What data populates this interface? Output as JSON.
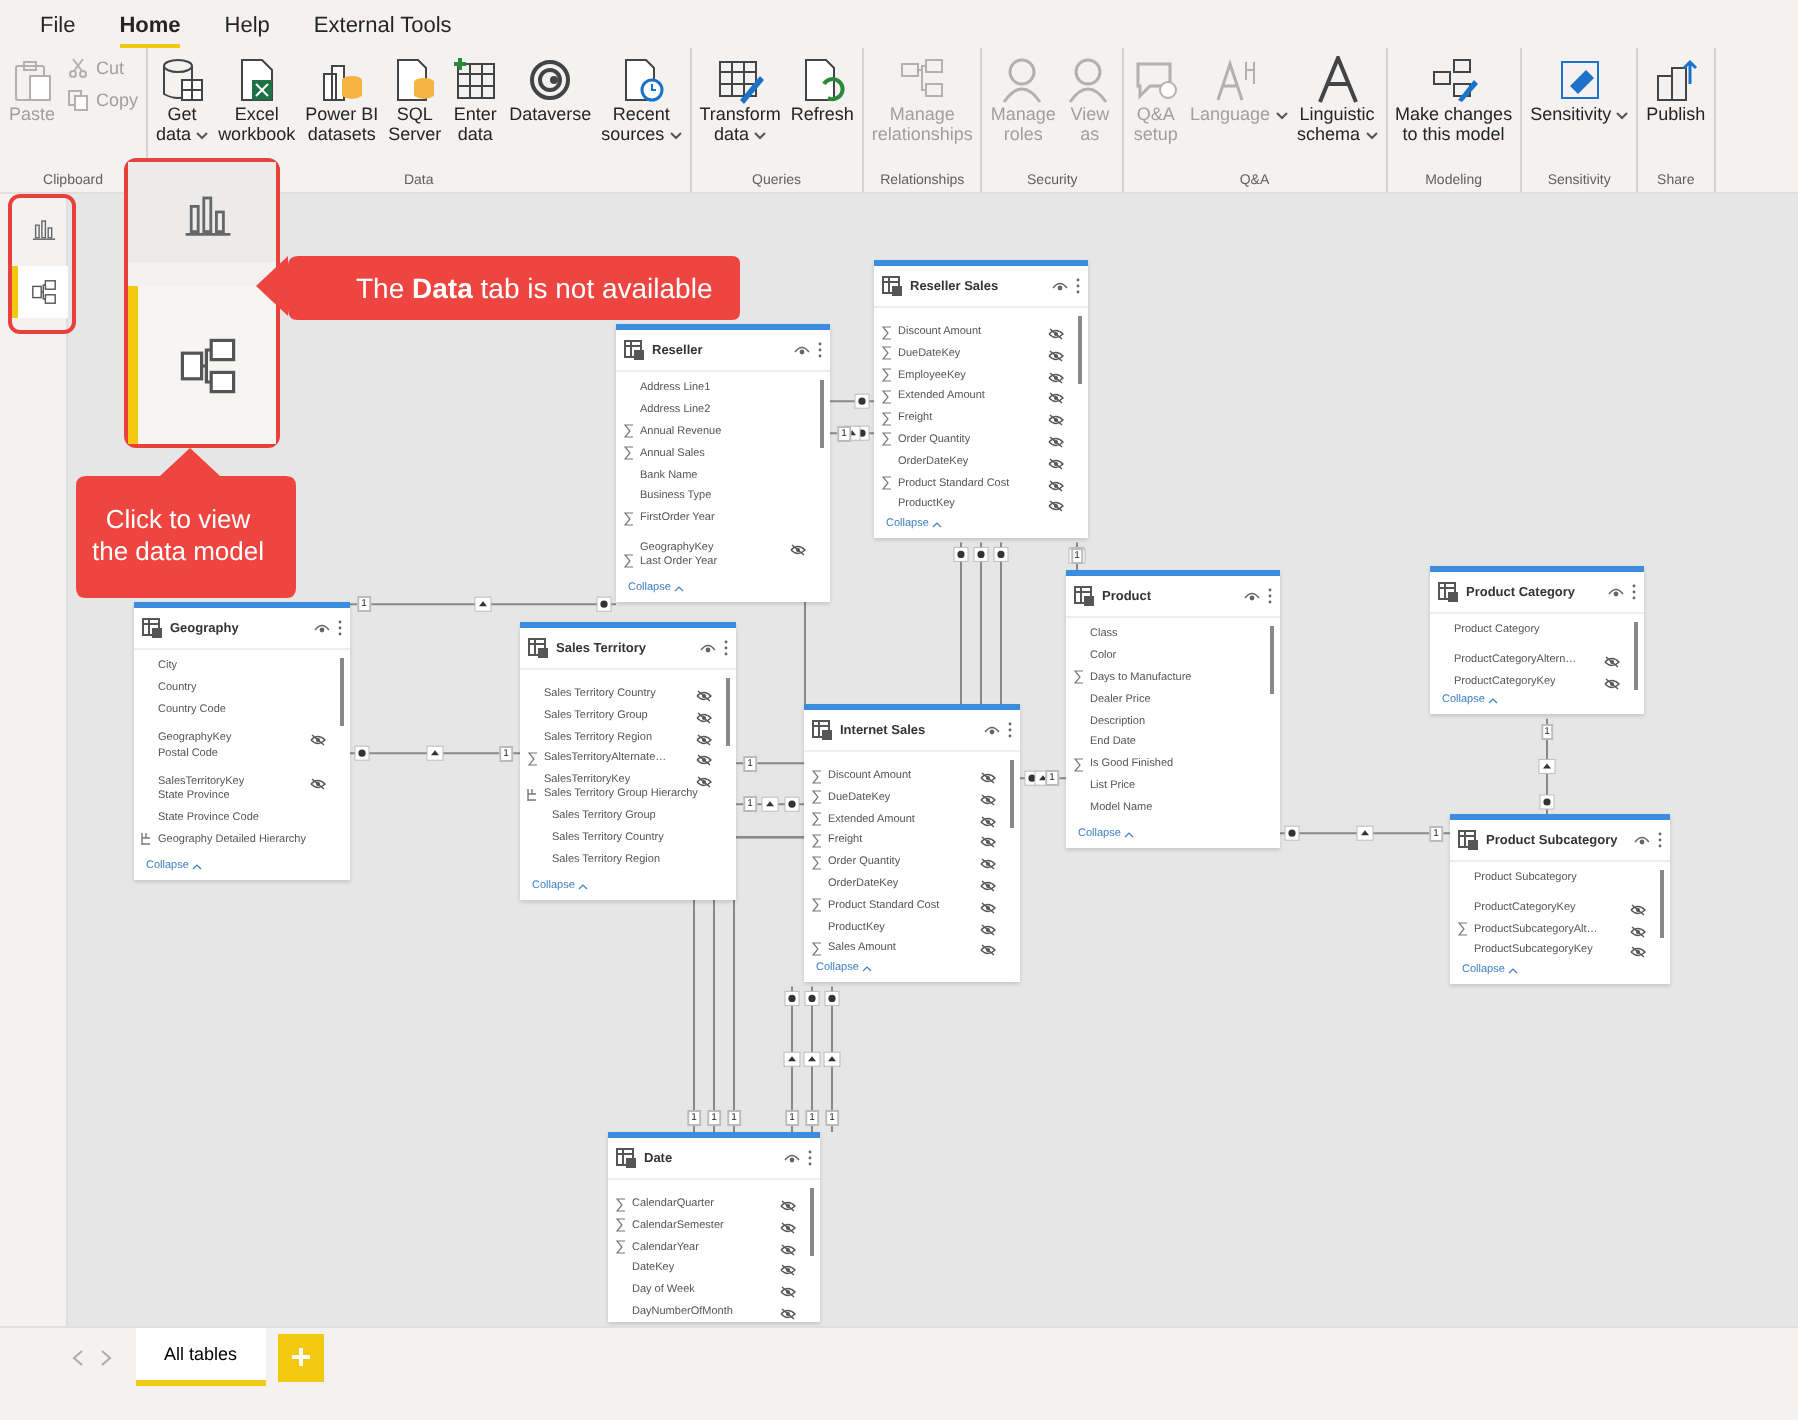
{
  "menu_tabs": [
    {
      "label": "File",
      "selected": false
    },
    {
      "label": "Home",
      "selected": true
    },
    {
      "label": "Help",
      "selected": false
    },
    {
      "label": "External Tools",
      "selected": false
    }
  ],
  "ribbon_groups": [
    {
      "label": "Clipboard",
      "buttons": [
        {
          "label": "Paste",
          "kind": "large",
          "disabled": true,
          "dropdown": false
        },
        {
          "label": "Cut",
          "kind": "small",
          "disabled": true,
          "dropdown": false
        },
        {
          "label": "Copy",
          "kind": "small",
          "disabled": true,
          "dropdown": false
        }
      ]
    },
    {
      "label": "Data",
      "buttons": [
        {
          "label": "Get\ndata",
          "kind": "large",
          "disabled": false,
          "dropdown": true
        },
        {
          "label": "Excel\nworkbook",
          "kind": "large",
          "disabled": false,
          "dropdown": false
        },
        {
          "label": "Power BI\ndatasets",
          "kind": "large",
          "disabled": false,
          "dropdown": false
        },
        {
          "label": "SQL\nServer",
          "kind": "large",
          "disabled": false,
          "dropdown": false
        },
        {
          "label": "Enter\ndata",
          "kind": "large",
          "disabled": false,
          "dropdown": false
        },
        {
          "label": "Dataverse",
          "kind": "large",
          "disabled": false,
          "dropdown": false
        },
        {
          "label": "Recent\nsources",
          "kind": "large",
          "disabled": false,
          "dropdown": true
        }
      ]
    },
    {
      "label": "Queries",
      "buttons": [
        {
          "label": "Transform\ndata",
          "kind": "large",
          "disabled": false,
          "dropdown": true
        },
        {
          "label": "Refresh",
          "kind": "large",
          "disabled": false,
          "dropdown": false
        }
      ]
    },
    {
      "label": "Relationships",
      "buttons": [
        {
          "label": "Manage\nrelationships",
          "kind": "large",
          "disabled": true,
          "dropdown": false
        }
      ]
    },
    {
      "label": "Security",
      "buttons": [
        {
          "label": "Manage\nroles",
          "kind": "large",
          "disabled": true,
          "dropdown": false
        },
        {
          "label": "View\nas",
          "kind": "large",
          "disabled": true,
          "dropdown": false
        }
      ]
    },
    {
      "label": "Q&A",
      "buttons": [
        {
          "label": "Q&A\nsetup",
          "kind": "large",
          "disabled": true,
          "dropdown": false
        },
        {
          "label": "Language",
          "kind": "large",
          "disabled": true,
          "dropdown": true
        },
        {
          "label": "Linguistic\nschema",
          "kind": "large",
          "disabled": false,
          "dropdown": true
        }
      ]
    },
    {
      "label": "Modeling",
      "buttons": [
        {
          "label": "Make changes\nto this model",
          "kind": "large",
          "disabled": false,
          "dropdown": false
        }
      ]
    },
    {
      "label": "Sensitivity",
      "buttons": [
        {
          "label": "Sensitivity",
          "kind": "large",
          "disabled": false,
          "dropdown": true
        }
      ]
    },
    {
      "label": "Share",
      "buttons": [
        {
          "label": "Publish",
          "kind": "large",
          "disabled": false,
          "dropdown": false
        }
      ]
    }
  ],
  "nav_items": [
    {
      "selected": false
    },
    {
      "selected": true
    }
  ],
  "zoom_inset": {
    "items": [
      {
        "selected": false
      },
      {
        "selected": true
      }
    ]
  },
  "callouts": [
    {
      "text": "The **Data** tab is not available"
    },
    {
      "text": "Click to view the data model"
    }
  ],
  "tables": [
    {
      "name": "Reseller",
      "collapse": "Collapse",
      "fields": [
        {
          "name": "Address Line1",
          "kind": "column",
          "hidden": false
        },
        {
          "name": "Address Line2",
          "kind": "column",
          "hidden": false
        },
        {
          "name": "Annual Revenue",
          "kind": "measure",
          "hidden": false
        },
        {
          "name": "Annual Sales",
          "kind": "measure",
          "hidden": false
        },
        {
          "name": "Bank Name",
          "kind": "column",
          "hidden": false
        },
        {
          "name": "Business Type",
          "kind": "column",
          "hidden": false
        },
        {
          "name": "FirstOrder Year",
          "kind": "measure",
          "hidden": false
        },
        {
          "name": "GeographyKey",
          "kind": "column",
          "hidden": true
        },
        {
          "name": "Last Order Year",
          "kind": "measure",
          "hidden": false
        }
      ]
    },
    {
      "name": "Reseller Sales",
      "collapse": "Collapse",
      "fields": [
        {
          "name": "Discount Amount",
          "kind": "measure",
          "hidden": true
        },
        {
          "name": "DueDateKey",
          "kind": "measure",
          "hidden": true
        },
        {
          "name": "EmployeeKey",
          "kind": "measure",
          "hidden": true
        },
        {
          "name": "Extended Amount",
          "kind": "measure",
          "hidden": true
        },
        {
          "name": "Freight",
          "kind": "measure",
          "hidden": true
        },
        {
          "name": "Order Quantity",
          "kind": "measure",
          "hidden": true
        },
        {
          "name": "OrderDateKey",
          "kind": "column",
          "hidden": true
        },
        {
          "name": "Product Standard Cost",
          "kind": "measure",
          "hidden": true
        },
        {
          "name": "ProductKey",
          "kind": "column",
          "hidden": true
        }
      ]
    },
    {
      "name": "Geography",
      "collapse": "Collapse",
      "fields": [
        {
          "name": "City",
          "kind": "column",
          "hidden": false
        },
        {
          "name": "Country",
          "kind": "column",
          "hidden": false
        },
        {
          "name": "Country Code",
          "kind": "column",
          "hidden": false
        },
        {
          "name": "GeographyKey",
          "kind": "column",
          "hidden": true
        },
        {
          "name": "Postal Code",
          "kind": "column",
          "hidden": false
        },
        {
          "name": "SalesTerritoryKey",
          "kind": "column",
          "hidden": true
        },
        {
          "name": "State Province",
          "kind": "column",
          "hidden": false
        },
        {
          "name": "State Province Code",
          "kind": "column",
          "hidden": false
        },
        {
          "name": "Geography Detailed Hierarchy",
          "kind": "hierarchy",
          "hidden": false
        }
      ]
    },
    {
      "name": "Sales Territory",
      "collapse": "Collapse",
      "fields": [
        {
          "name": "Sales Territory Country",
          "kind": "column",
          "hidden": true
        },
        {
          "name": "Sales Territory Group",
          "kind": "column",
          "hidden": true
        },
        {
          "name": "Sales Territory Region",
          "kind": "column",
          "hidden": true
        },
        {
          "name": "SalesTerritoryAlternate…",
          "kind": "measure",
          "hidden": true
        },
        {
          "name": "SalesTerritoryKey",
          "kind": "column",
          "hidden": true
        },
        {
          "name": "Sales Territory Group Hierarchy",
          "kind": "hierarchy",
          "hidden": false
        },
        {
          "name": "Sales Territory Group",
          "kind": "level",
          "hidden": false
        },
        {
          "name": "Sales Territory Country",
          "kind": "level",
          "hidden": false
        },
        {
          "name": "Sales Territory Region",
          "kind": "level",
          "hidden": false
        }
      ]
    },
    {
      "name": "Internet Sales",
      "collapse": "Collapse",
      "fields": [
        {
          "name": "Discount Amount",
          "kind": "measure",
          "hidden": true
        },
        {
          "name": "DueDateKey",
          "kind": "measure",
          "hidden": true
        },
        {
          "name": "Extended Amount",
          "kind": "measure",
          "hidden": true
        },
        {
          "name": "Freight",
          "kind": "measure",
          "hidden": true
        },
        {
          "name": "Order Quantity",
          "kind": "measure",
          "hidden": true
        },
        {
          "name": "OrderDateKey",
          "kind": "column",
          "hidden": true
        },
        {
          "name": "Product Standard Cost",
          "kind": "measure",
          "hidden": true
        },
        {
          "name": "ProductKey",
          "kind": "column",
          "hidden": true
        },
        {
          "name": "Sales Amount",
          "kind": "measure",
          "hidden": true
        }
      ]
    },
    {
      "name": "Product",
      "collapse": "Collapse",
      "fields": [
        {
          "name": "Class",
          "kind": "column",
          "hidden": false
        },
        {
          "name": "Color",
          "kind": "column",
          "hidden": false
        },
        {
          "name": "Days to Manufacture",
          "kind": "measure",
          "hidden": false
        },
        {
          "name": "Dealer Price",
          "kind": "column",
          "hidden": false
        },
        {
          "name": "Description",
          "kind": "column",
          "hidden": false
        },
        {
          "name": "End Date",
          "kind": "column",
          "hidden": false
        },
        {
          "name": "Is Good Finished",
          "kind": "measure",
          "hidden": false
        },
        {
          "name": "List Price",
          "kind": "column",
          "hidden": false
        },
        {
          "name": "Model Name",
          "kind": "column",
          "hidden": false
        }
      ]
    },
    {
      "name": "Product Category",
      "collapse": "Collapse",
      "fields": [
        {
          "name": "Product Category",
          "kind": "column",
          "hidden": false
        },
        {
          "name": "ProductCategoryAltern…",
          "kind": "column",
          "hidden": true
        },
        {
          "name": "ProductCategoryKey",
          "kind": "column",
          "hidden": true
        }
      ]
    },
    {
      "name": "Product Subcategory",
      "collapse": "Collapse",
      "fields": [
        {
          "name": "Product Subcategory",
          "kind": "column",
          "hidden": false
        },
        {
          "name": "ProductCategoryKey",
          "kind": "column",
          "hidden": true
        },
        {
          "name": "ProductSubcategoryAlt…",
          "kind": "measure",
          "hidden": true
        },
        {
          "name": "ProductSubcategoryKey",
          "kind": "column",
          "hidden": true
        }
      ]
    },
    {
      "name": "Date",
      "fields": [
        {
          "name": "CalendarQuarter",
          "kind": "measure",
          "hidden": true
        },
        {
          "name": "CalendarSemester",
          "kind": "measure",
          "hidden": true
        },
        {
          "name": "CalendarYear",
          "kind": "measure",
          "hidden": true
        },
        {
          "name": "DateKey",
          "kind": "column",
          "hidden": true
        },
        {
          "name": "Day of Week",
          "kind": "column",
          "hidden": true
        },
        {
          "name": "DayNumberOfMonth",
          "kind": "column",
          "hidden": true
        }
      ]
    }
  ],
  "relationships": [
    {
      "one_label": "1"
    },
    {
      "one_label": "1"
    },
    {
      "one_label": "1"
    },
    {
      "one_label": "1"
    },
    {
      "one_label": "1"
    },
    {
      "one_label": "1"
    },
    {
      "one_label": "1"
    },
    {
      "one_label": "1"
    },
    {
      "one_label": "1"
    },
    {
      "one_label": "1"
    },
    {
      "one_label": "1"
    },
    {
      "one_label": "1"
    },
    {
      "one_label": "1"
    },
    {
      "one_label": "1"
    },
    {
      "one_label": "1"
    }
  ],
  "page_tabs": [
    {
      "label": "All tables",
      "selected": true
    }
  ]
}
